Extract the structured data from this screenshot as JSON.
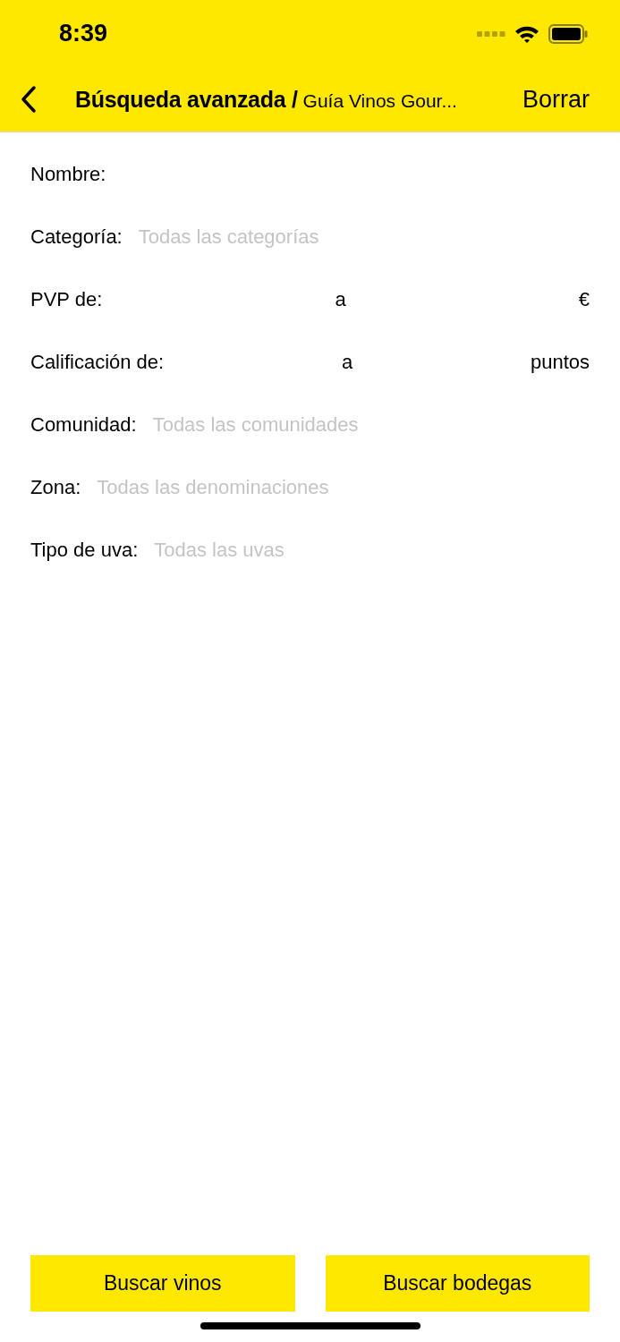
{
  "status_bar": {
    "time": "8:39"
  },
  "nav_bar": {
    "title": "Búsqueda avanzada /",
    "subtitle": "Guía Vinos Gour...",
    "action": "Borrar"
  },
  "fields": [
    {
      "kind": "text",
      "label": "Nombre:"
    },
    {
      "kind": "text",
      "label": "Categoría:",
      "placeholder": "Todas las categorías"
    },
    {
      "kind": "range",
      "label": "PVP de:",
      "separator": "a",
      "unit": "€"
    },
    {
      "kind": "range",
      "label": "Calificación de:",
      "separator": "a",
      "unit": "puntos"
    },
    {
      "kind": "text",
      "label": "Comunidad:",
      "placeholder": "Todas las comunidades"
    },
    {
      "kind": "text",
      "label": "Zona:",
      "placeholder": "Todas las denominaciones"
    },
    {
      "kind": "text",
      "label": "Tipo de uva:",
      "placeholder": "Todas las uvas"
    }
  ],
  "buttons": [
    "Buscar vinos",
    "Buscar bodegas"
  ]
}
